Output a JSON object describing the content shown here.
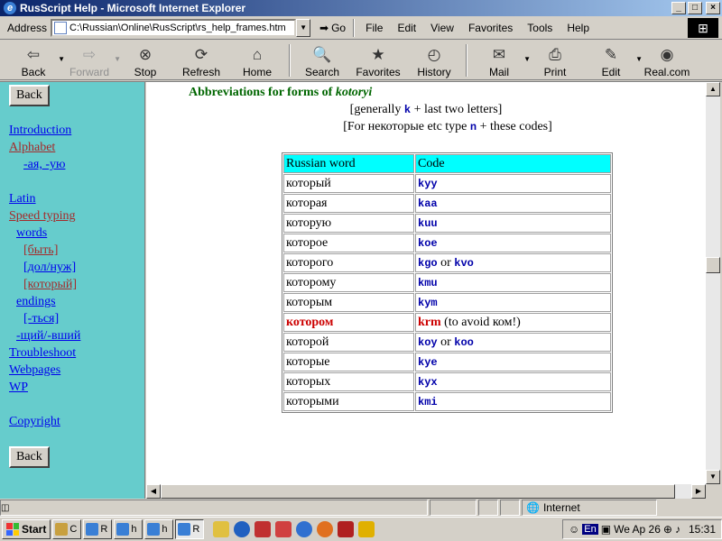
{
  "window": {
    "title": "RusScript Help - Microsoft Internet Explorer",
    "controls": [
      "_",
      "□",
      "×"
    ]
  },
  "address_bar": {
    "label": "Address",
    "url": "C:\\Russian\\Online\\RusScript\\rs_help_frames.htm",
    "go_label": "Go"
  },
  "menu": [
    "File",
    "Edit",
    "View",
    "Favorites",
    "Tools",
    "Help"
  ],
  "toolbar": [
    {
      "label": "Back",
      "icon": "back-arrow-icon",
      "glyph": "⇦",
      "dropdown": true
    },
    {
      "label": "Forward",
      "icon": "forward-arrow-icon",
      "glyph": "⇨",
      "dropdown": true,
      "disabled": true
    },
    {
      "label": "Stop",
      "icon": "stop-icon",
      "glyph": "⊗"
    },
    {
      "label": "Refresh",
      "icon": "refresh-icon",
      "glyph": "⟳"
    },
    {
      "label": "Home",
      "icon": "home-icon",
      "glyph": "⌂"
    },
    {
      "label": "Search",
      "icon": "search-icon",
      "glyph": "🔍"
    },
    {
      "label": "Favorites",
      "icon": "favorites-icon",
      "glyph": "★"
    },
    {
      "label": "History",
      "icon": "history-icon",
      "glyph": "◴"
    },
    {
      "label": "Mail",
      "icon": "mail-icon",
      "glyph": "✉",
      "dropdown": true
    },
    {
      "label": "Print",
      "icon": "print-icon",
      "glyph": "⎙"
    },
    {
      "label": "Edit",
      "icon": "edit-icon",
      "glyph": "✎",
      "dropdown": true
    },
    {
      "label": "Real.com",
      "icon": "real-icon",
      "glyph": "◉"
    }
  ],
  "sidebar": {
    "back_top": "Back",
    "back_bottom": "Back",
    "links": [
      {
        "label": "Introduction",
        "level": 0,
        "visited": false
      },
      {
        "label": "Alphabet",
        "level": 0,
        "visited": true
      },
      {
        "label": "-ая, -ую",
        "level": 2,
        "visited": false
      },
      {
        "label": "",
        "level": 0,
        "gap": true
      },
      {
        "label": "Latin",
        "level": 0,
        "visited": false
      },
      {
        "label": "Speed typing",
        "level": 0,
        "visited": true
      },
      {
        "label": "words",
        "level": 1,
        "visited": false
      },
      {
        "label": "[быть]",
        "level": 2,
        "visited": true
      },
      {
        "label": "[дол/нуж]",
        "level": 2,
        "visited": false
      },
      {
        "label": "[который]",
        "level": 2,
        "visited": true
      },
      {
        "label": "endings",
        "level": 1,
        "visited": false
      },
      {
        "label": "[-ться]",
        "level": 2,
        "visited": false
      },
      {
        "label": "-щий/-вший",
        "level": 1,
        "visited": false
      },
      {
        "label": "Troubleshoot",
        "level": 0,
        "visited": false
      },
      {
        "label": "Webpages",
        "level": 0,
        "visited": false
      },
      {
        "label": "WP",
        "level": 0,
        "visited": false
      },
      {
        "label": "",
        "level": 0,
        "gap": true
      },
      {
        "label": "Copyright",
        "level": 0,
        "visited": false
      }
    ]
  },
  "main": {
    "heading_prefix": "Abbreviations for forms of ",
    "heading_word": "kotoryi",
    "note1": {
      "open": "[generally ",
      "code": "k",
      "close": " + last two letters]"
    },
    "note2": {
      "open": "[For некоторые etc type ",
      "code": "n",
      "close": " + these codes]"
    },
    "table": {
      "headers": [
        "Russian word",
        "Code"
      ],
      "rows": [
        {
          "word": "который",
          "code": "kyy"
        },
        {
          "word": "которая",
          "code": "kaa"
        },
        {
          "word": "которую",
          "code": "kuu"
        },
        {
          "word": "которое",
          "code": "koe"
        },
        {
          "word": "которого",
          "code": "kgo",
          "or": " or ",
          "code2": "kvo"
        },
        {
          "word": "которому",
          "code": "kmu"
        },
        {
          "word": "которым",
          "code": "kym"
        },
        {
          "word": "котором",
          "code": "krm",
          "note": " (to avoid ком!)",
          "highlight": true
        },
        {
          "word": "которой",
          "code": "koy",
          "or": " or ",
          "code2": "koo"
        },
        {
          "word": "которые",
          "code": "kye"
        },
        {
          "word": "которых",
          "code": "kyx"
        },
        {
          "word": "которыми",
          "code": "kmi"
        }
      ]
    }
  },
  "status": {
    "zone": "Internet"
  },
  "taskbar": {
    "start": "Start",
    "buttons": [
      "C",
      "R",
      "h",
      "h",
      "R"
    ],
    "tray_lang": "En",
    "tray_text": "We Ap 26",
    "clock": "15:31"
  }
}
